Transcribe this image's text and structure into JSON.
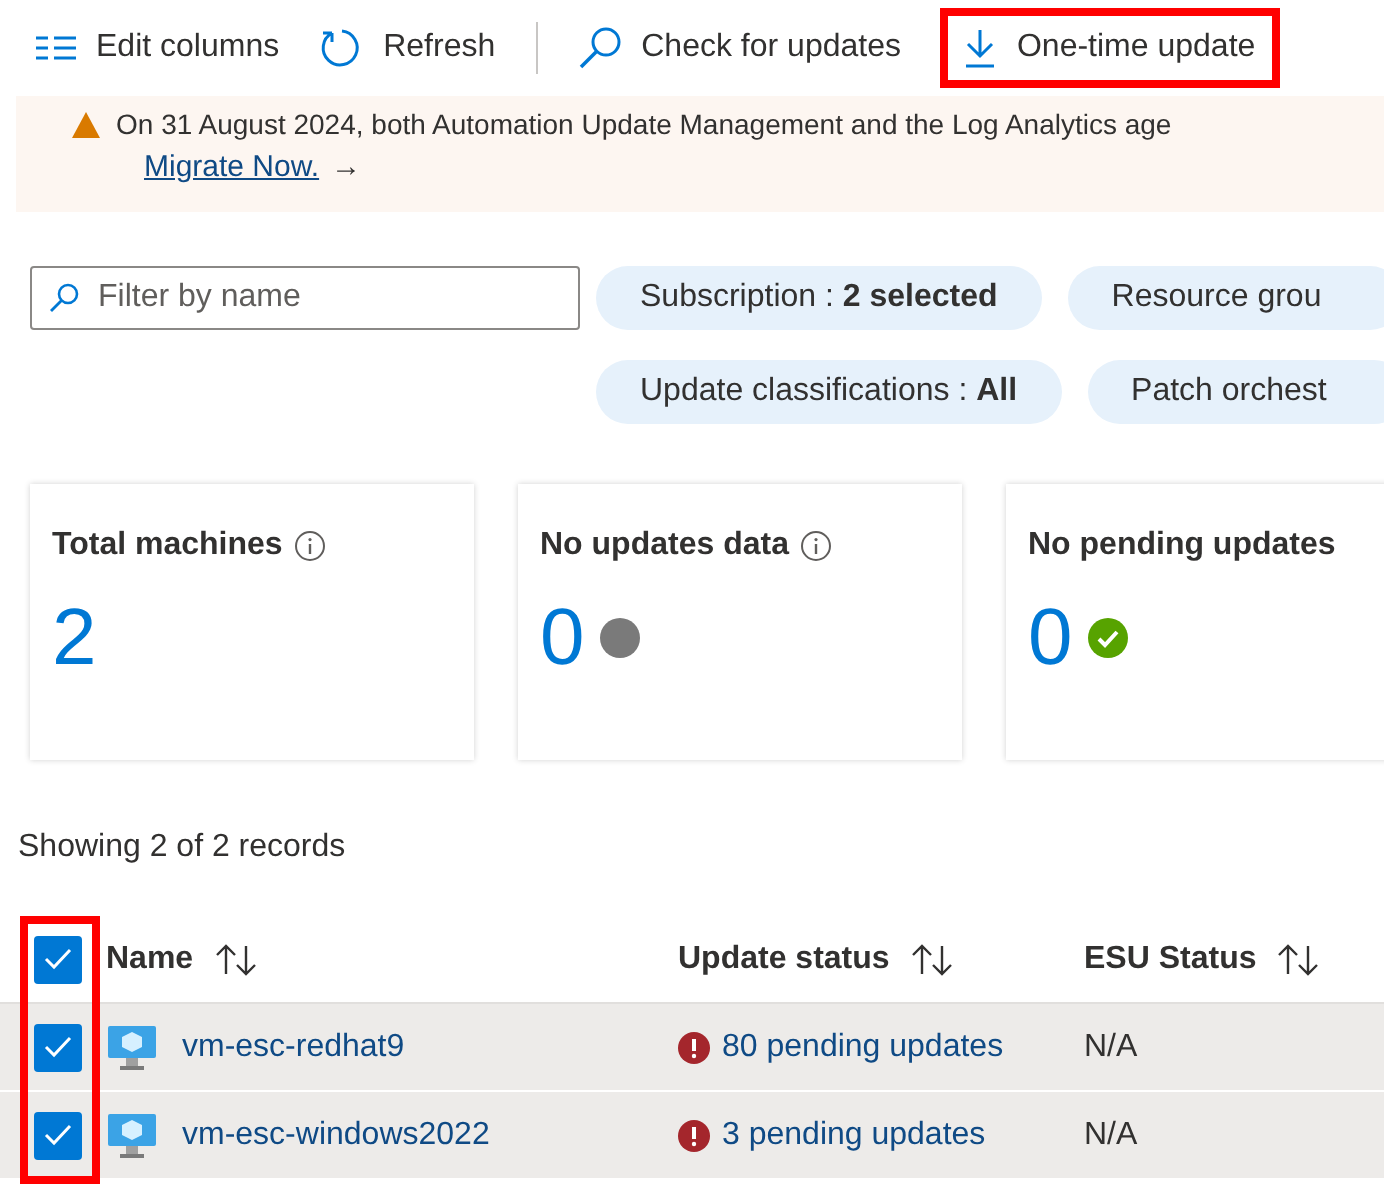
{
  "toolbar": [
    {
      "kind": "columns",
      "label": "Edit columns",
      "highlighted": false
    },
    {
      "kind": "refresh",
      "label": "Refresh",
      "highlighted": false
    },
    {
      "kind": "separator"
    },
    {
      "kind": "search",
      "label": "Check for updates",
      "highlighted": false
    },
    {
      "kind": "download",
      "label": "One-time update",
      "highlighted": true
    }
  ],
  "banner": {
    "text": "On 31 August 2024, both Automation Update Management and the Log Analytics age",
    "link": "Migrate Now.",
    "arrow": "→"
  },
  "filter": {
    "placeholder": "Filter by name"
  },
  "chip_rows": [
    [
      "Subscription : **2 selected**",
      "Resource grou"
    ],
    [
      "Update classifications : **All**",
      "Patch orchest"
    ]
  ],
  "cards": [
    {
      "title": "Total machines",
      "info": true,
      "value": "2",
      "kind": "none"
    },
    {
      "title": "No updates data",
      "info": true,
      "value": "0",
      "kind": "unknown"
    },
    {
      "title": "No pending updates",
      "info": false,
      "value": "0",
      "kind": "ok"
    }
  ],
  "records_summary": "Showing 2 of 2 records",
  "table": {
    "select_all_checked": true,
    "checkbox_column_highlighted": true,
    "columns": [
      "Name",
      "Update status",
      "ESU Status"
    ],
    "rows": [
      {
        "checked": true,
        "name": "vm-esc-redhat9",
        "update_status": "80 pending updates",
        "esu_status": "N/A"
      },
      {
        "checked": true,
        "name": "vm-esc-windows2022",
        "update_status": "3 pending updates",
        "esu_status": "N/A"
      }
    ]
  }
}
